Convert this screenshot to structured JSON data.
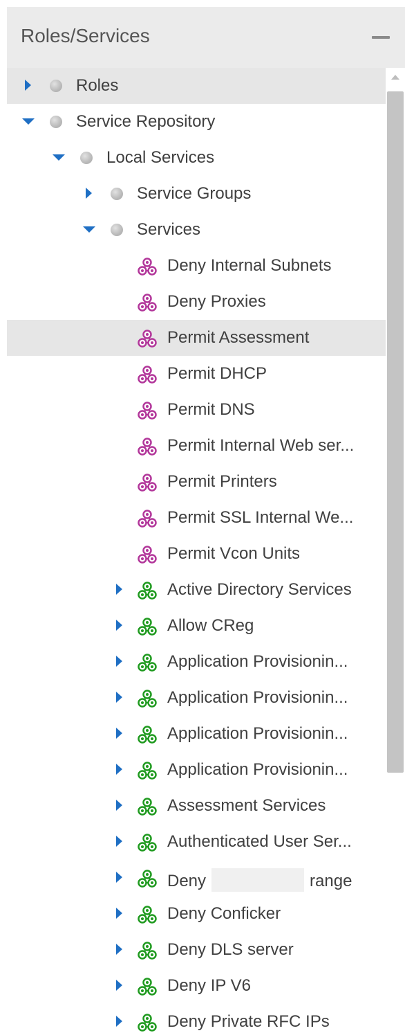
{
  "panel": {
    "title": "Roles/Services",
    "collapse_icon": "minus-icon"
  },
  "tree": [
    {
      "label": "Roles",
      "kind": "folder",
      "expander": "collapsed",
      "level": 0,
      "highlight": true
    },
    {
      "label": "Service Repository",
      "kind": "folder",
      "expander": "expanded",
      "level": 0
    },
    {
      "label": "Local Services",
      "kind": "folder",
      "expander": "expanded",
      "level": 1
    },
    {
      "label": "Service Groups",
      "kind": "folder",
      "expander": "collapsed",
      "level": 2
    },
    {
      "label": "Services",
      "kind": "folder",
      "expander": "expanded",
      "level": 2
    },
    {
      "label": "Deny Internal Subnets",
      "kind": "service",
      "color": "#b2369a",
      "expander": "none",
      "level": 3
    },
    {
      "label": "Deny Proxies",
      "kind": "service",
      "color": "#b2369a",
      "expander": "none",
      "level": 3
    },
    {
      "label": "Permit Assessment",
      "kind": "service",
      "color": "#b2369a",
      "expander": "none",
      "level": 3,
      "highlight": true
    },
    {
      "label": "Permit DHCP",
      "kind": "service",
      "color": "#b2369a",
      "expander": "none",
      "level": 3
    },
    {
      "label": "Permit DNS",
      "kind": "service",
      "color": "#b2369a",
      "expander": "none",
      "level": 3
    },
    {
      "label": "Permit Internal Web ser...",
      "kind": "service",
      "color": "#b2369a",
      "expander": "none",
      "level": 3
    },
    {
      "label": "Permit Printers",
      "kind": "service",
      "color": "#b2369a",
      "expander": "none",
      "level": 3
    },
    {
      "label": "Permit SSL Internal We...",
      "kind": "service",
      "color": "#b2369a",
      "expander": "none",
      "level": 3
    },
    {
      "label": "Permit Vcon Units",
      "kind": "service",
      "color": "#b2369a",
      "expander": "none",
      "level": 3
    },
    {
      "label": "Active Directory Services",
      "kind": "service-group",
      "color": "#1f9a1f",
      "expander": "collapsed",
      "level": 3
    },
    {
      "label": "Allow CReg",
      "kind": "service-group",
      "color": "#1f9a1f",
      "expander": "collapsed",
      "level": 3
    },
    {
      "label": "Application Provisionin...",
      "kind": "service-group",
      "color": "#1f9a1f",
      "expander": "collapsed",
      "level": 3
    },
    {
      "label": "Application Provisionin...",
      "kind": "service-group",
      "color": "#1f9a1f",
      "expander": "collapsed",
      "level": 3
    },
    {
      "label": "Application Provisionin...",
      "kind": "service-group",
      "color": "#1f9a1f",
      "expander": "collapsed",
      "level": 3
    },
    {
      "label": "Application Provisionin...",
      "kind": "service-group",
      "color": "#1f9a1f",
      "expander": "collapsed",
      "level": 3
    },
    {
      "label": "Assessment Services",
      "kind": "service-group",
      "color": "#1f9a1f",
      "expander": "collapsed",
      "level": 3
    },
    {
      "label": "Authenticated User Ser...",
      "kind": "service-group",
      "color": "#1f9a1f",
      "expander": "collapsed",
      "level": 3
    },
    {
      "label": "Deny",
      "label_suffix": "range",
      "redacted": true,
      "kind": "service-group",
      "color": "#1f9a1f",
      "expander": "collapsed",
      "level": 3
    },
    {
      "label": "Deny Conficker",
      "kind": "service-group",
      "color": "#1f9a1f",
      "expander": "collapsed",
      "level": 3
    },
    {
      "label": "Deny DLS server",
      "kind": "service-group",
      "color": "#1f9a1f",
      "expander": "collapsed",
      "level": 3
    },
    {
      "label": "Deny IP V6",
      "kind": "service-group",
      "color": "#1f9a1f",
      "expander": "collapsed",
      "level": 3
    },
    {
      "label": "Deny Private RFC IPs",
      "kind": "service-group",
      "color": "#1f9a1f",
      "expander": "collapsed",
      "level": 3
    }
  ],
  "scrollbar": {
    "up_icon": "scroll-up-arrow-icon"
  }
}
